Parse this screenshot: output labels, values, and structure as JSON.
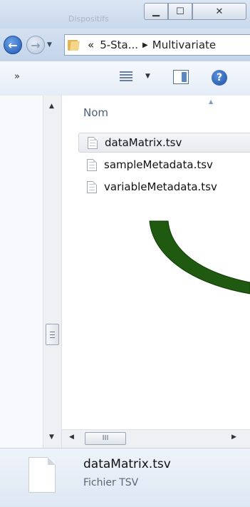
{
  "window": {
    "title_faded": "Dispositifs",
    "minimize_symbol": "▁",
    "maximize_symbol": "☐",
    "close_symbol": "✕"
  },
  "nav": {
    "back_symbol": "←",
    "forward_symbol": "→",
    "history_symbol": "▼",
    "overflow_symbol": "«",
    "breadcrumb": [
      "5-Sta...",
      "Multivariate"
    ],
    "separator_symbol": "▶"
  },
  "toolbar": {
    "more_symbol": "»",
    "view_menu_symbol": "▼",
    "help_label": "?"
  },
  "file_list": {
    "column_header": "Nom",
    "sort_symbol": "▲",
    "files": [
      {
        "name": "dataMatrix.tsv",
        "selected": true
      },
      {
        "name": "sampleMetadata.tsv",
        "selected": false
      },
      {
        "name": "variableMetadata.tsv",
        "selected": false
      }
    ]
  },
  "scrollbars": {
    "up_symbol": "▲",
    "down_symbol": "▼",
    "left_symbol": "◀",
    "right_symbol": "▶",
    "thumb_grip": "III"
  },
  "details": {
    "file_name": "dataMatrix.tsv",
    "file_type": "Fichier TSV"
  },
  "colors": {
    "annotation_arrow": "#1f5a10"
  }
}
